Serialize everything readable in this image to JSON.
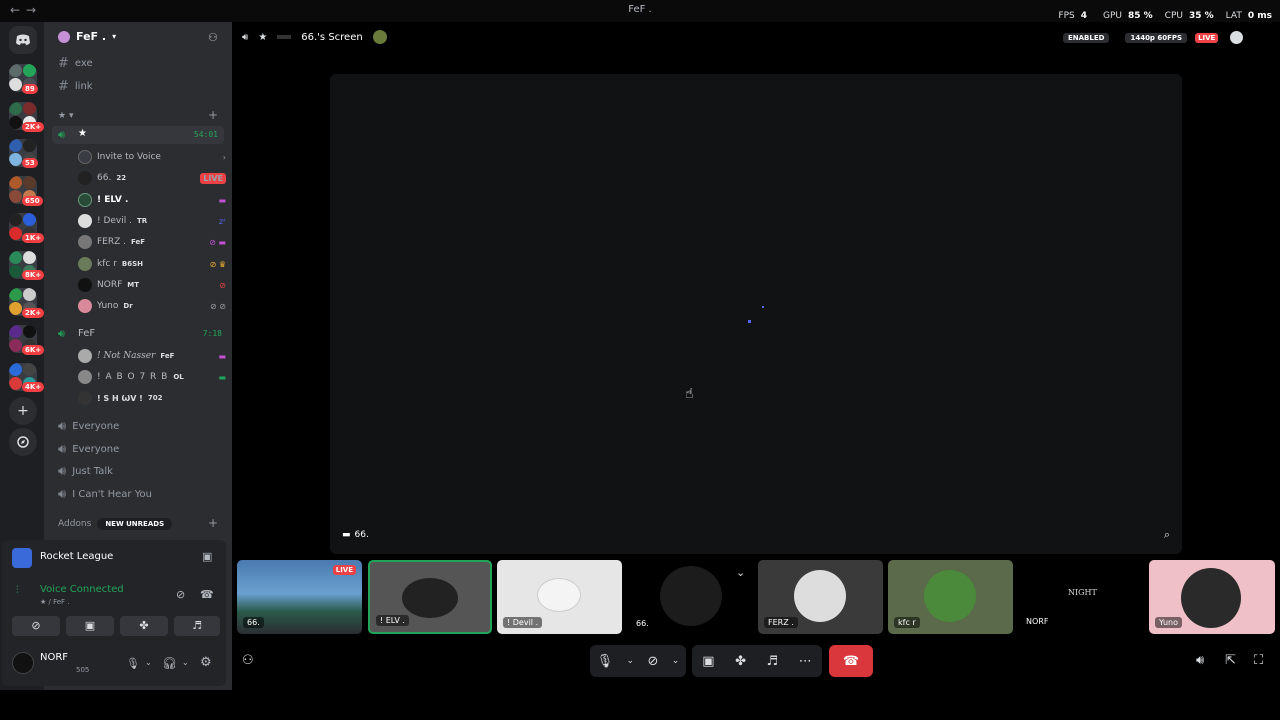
{
  "window": {
    "title": "FeF .",
    "back_glyph": "←",
    "forward_glyph": "→"
  },
  "perf": {
    "fps_label": "FPS",
    "fps": "4",
    "gpu_label": "GPU",
    "gpu": "85 %",
    "cpu_label": "CPU",
    "cpu": "35 %",
    "lat_label": "LAT",
    "lat": "0 ms"
  },
  "rail": {
    "badges": [
      "89",
      "2K+",
      "53",
      "650",
      "1K+",
      "8K+",
      "2K+",
      "6K+",
      "4K+"
    ]
  },
  "server": {
    "name": "FeF .",
    "icon": "chevron-down-icon"
  },
  "channels_top": [
    "exe",
    "link"
  ],
  "voice_category": "★",
  "voice_channel": {
    "name": "★",
    "timer": "54:01"
  },
  "invite": "Invite to Voice",
  "members_a": [
    {
      "name": "66.",
      "tag": "22",
      "live": "LIVE"
    },
    {
      "name": "! ELV .",
      "tag": ""
    },
    {
      "name": "! Devil .",
      "tag": "TR"
    },
    {
      "name": "FERZ .",
      "tag": "FeF"
    },
    {
      "name": "kfc r",
      "tag": "B6SH"
    },
    {
      "name": "NORF",
      "tag": "MT"
    },
    {
      "name": "Yuno",
      "tag": "Dr"
    }
  ],
  "voice_channel2": {
    "name": "FeF",
    "timer": "7:18"
  },
  "members_b": [
    {
      "name": "! Not Nasser",
      "tag": "FeF"
    },
    {
      "name": "! A B O 7 R B",
      "tag": "OL"
    },
    {
      "name": "! S H ѠV !",
      "tag": "702"
    }
  ],
  "voice_channels": [
    "Everyone",
    "Everyone",
    "Just Talk",
    "I Can't Hear You"
  ],
  "addons": {
    "label": "Addons",
    "unreads": "NEW UNREADS"
  },
  "activity": {
    "game": "Rocket League",
    "status": "Voice Connected",
    "location": "★ / FeF ."
  },
  "user": {
    "name": "NORF",
    "sub": "505"
  },
  "stream": {
    "title": "66.'s Screen",
    "enabled": "ENABLED",
    "quality": "1440p 60FPS",
    "live": "LIVE",
    "owner": "66."
  },
  "tiles": [
    {
      "name": "66.",
      "live": "LIVE"
    },
    {
      "name": "! ELV ."
    },
    {
      "name": "! Devil ."
    },
    {
      "name": "66."
    },
    {
      "name": "FERZ ."
    },
    {
      "name": "kfc r"
    },
    {
      "name": "NORF",
      "text": "NIGHT"
    },
    {
      "name": "Yuno"
    }
  ],
  "colors": {
    "discord": "#5865f2",
    "live": "#ed4245",
    "green": "#23a559",
    "end": "#da373c"
  }
}
